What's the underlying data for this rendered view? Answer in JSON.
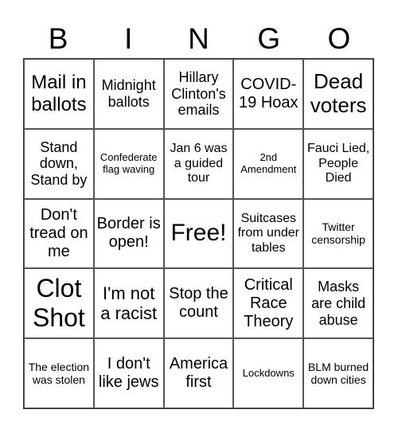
{
  "header": {
    "letters": [
      "B",
      "I",
      "N",
      "G",
      "O"
    ]
  },
  "cells": [
    "Mail in ballots",
    "Midnight ballots",
    "Hillary Clinton's emails",
    "COVID-19 Hoax",
    "Dead voters",
    "Stand down, Stand by",
    "Confederate flag waving",
    "Jan 6 was a guided tour",
    "2nd Amendment",
    "Fauci Lied, People Died",
    "Don't tread on me",
    "Border is open!",
    "Free!",
    "Suitcases from under tables",
    "Twitter censorship",
    "Clot Shot",
    "I'm not a racist",
    "Stop the count",
    "Critical Race Theory",
    "Masks are child abuse",
    "The election was stolen",
    "I don't like jews",
    "America first",
    "Lockdowns",
    "BLM burned down cities"
  ]
}
